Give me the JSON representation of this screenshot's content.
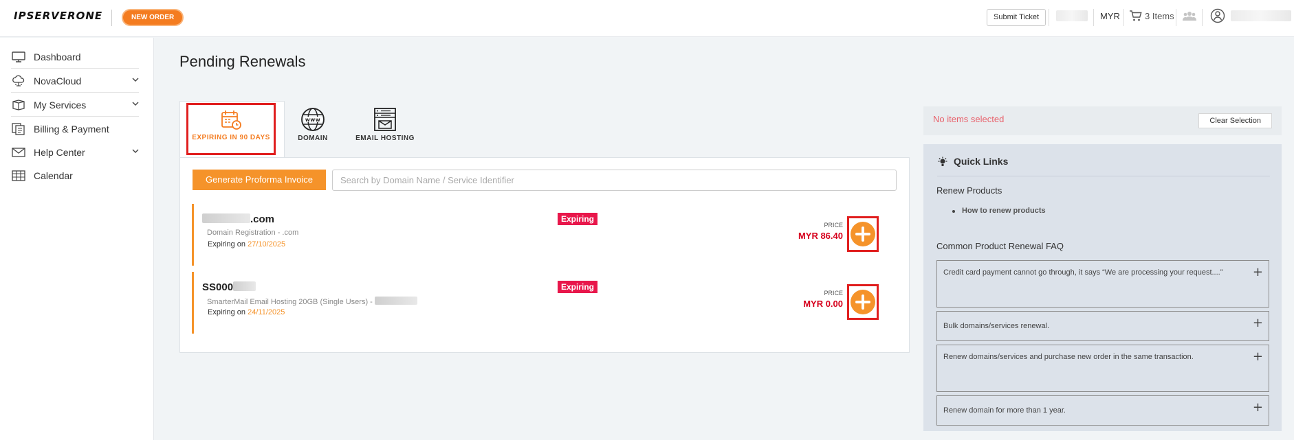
{
  "header": {
    "logo_text": "IPSERVERONE",
    "new_order_label": "NEW ORDER",
    "submit_ticket_label": "Submit Ticket",
    "currency": "MYR",
    "cart_label": "3 Items"
  },
  "sidebar": {
    "items": [
      {
        "label": "Dashboard",
        "icon": "monitor-icon"
      },
      {
        "label": "NovaCloud",
        "icon": "cloud-icon"
      },
      {
        "label": "My Services",
        "icon": "box-icon"
      },
      {
        "label": "Billing & Payment",
        "icon": "billing-icon"
      },
      {
        "label": "Help Center",
        "icon": "mail-icon"
      },
      {
        "label": "Calendar",
        "icon": "calendar-grid-icon"
      }
    ]
  },
  "page": {
    "title": "Pending Renewals"
  },
  "tabs": [
    {
      "label": "EXPIRING IN 90 DAYS",
      "icon": "calendar-clock-icon",
      "active": true
    },
    {
      "label": "DOMAIN",
      "icon": "globe-www-icon",
      "active": false
    },
    {
      "label": "EMAIL HOSTING",
      "icon": "email-hosting-icon",
      "active": false
    }
  ],
  "toolbar": {
    "generate_label": "Generate Proforma Invoice",
    "search_placeholder": "Search by Domain Name / Service Identifier"
  },
  "renewals": [
    {
      "name_suffix": ".com",
      "description": "Domain Registration - .com",
      "expiring_prefix": "Expiring on",
      "expiring_date": "27/10/2025",
      "status": "Expiring",
      "price_label": "PRICE",
      "price": "MYR 86.40"
    },
    {
      "name_prefix": "SS000",
      "description": "SmarterMail Email Hosting 20GB (Single Users) - ",
      "expiring_prefix": "Expiring on",
      "expiring_date": "24/11/2025",
      "status": "Expiring",
      "price_label": "PRICE",
      "price": "MYR 0.00"
    }
  ],
  "selection": {
    "status_text": "No items selected",
    "clear_label": "Clear Selection"
  },
  "quick_links": {
    "title": "Quick Links",
    "renew_heading": "Renew Products",
    "renew_link": "How to renew products",
    "faq_heading": "Common Product Renewal FAQ",
    "faqs": [
      "Credit card payment cannot go through, it says “We are processing your request....”",
      "Bulk domains/services renewal.",
      "Renew domains/services and purchase new order in the same transaction.",
      "Renew domain for more than 1 year."
    ]
  },
  "colors": {
    "accent_orange": "#f5932a",
    "badge_red": "#e8174b",
    "price_red": "#d6001c",
    "highlight_red": "#e01e1e"
  }
}
